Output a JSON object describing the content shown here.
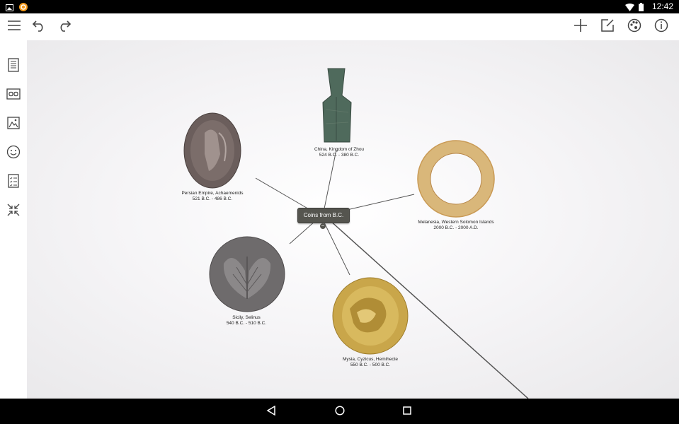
{
  "status_bar": {
    "time": "12:42",
    "icons": [
      "gallery-notification-icon",
      "app-notification-icon",
      "wifi-icon",
      "battery-icon"
    ]
  },
  "toolbar": {
    "left_icons": [
      "menu-icon",
      "undo-icon",
      "redo-icon"
    ],
    "right_icons": [
      "add-icon",
      "edit-note-icon",
      "palette-icon",
      "info-icon"
    ]
  },
  "sidebar": {
    "icons": [
      "document-icon",
      "link-icon",
      "image-icon",
      "emoji-icon",
      "checklist-icon",
      "collapse-icon"
    ]
  },
  "mindmap": {
    "center": "Coins from B.C.",
    "nodes": [
      {
        "line1": "China, Kingdom of Zhou",
        "line2": "524 B.C. - 380 B.C."
      },
      {
        "line1": "Persian Empire, Achaemenids",
        "line2": "521 B.C. - 486 B.C."
      },
      {
        "line1": "Melanesia, Western Solomon Islands",
        "line2": "2000 B.C. - 2000 A.D."
      },
      {
        "line1": "Sicily, Selinus",
        "line2": "540 B.C. - 510 B.C."
      },
      {
        "line1": "Mysia, Cyzicus, Hemihecte",
        "line2": "550 B.C. - 500 B.C."
      }
    ]
  },
  "nav_bar": {
    "icons": [
      "back-icon",
      "home-icon",
      "recents-icon"
    ]
  },
  "colors": {
    "node_bg": "#55554f",
    "toolbar_bg": "#ffffff",
    "canvas_bg": "#f3f2f4"
  }
}
